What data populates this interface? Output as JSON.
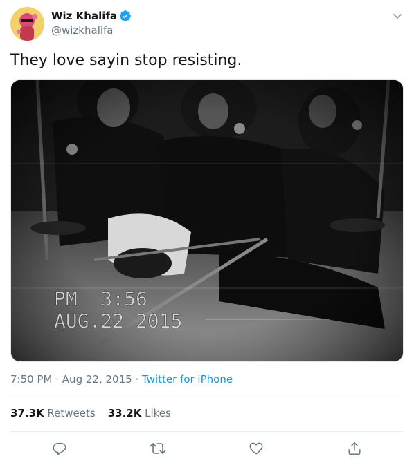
{
  "author": {
    "display_name": "Wiz Khalifa",
    "handle": "@wizkhalifa",
    "verified": true
  },
  "tweet": {
    "text": "They love sayin stop resisting.",
    "time": "7:50 PM",
    "separator": "·",
    "date": "Aug 22, 2015",
    "source": "Twitter for iPhone"
  },
  "media": {
    "timestamp_line1": "PM  3:56",
    "timestamp_line2": "AUG.22 2015"
  },
  "stats": {
    "retweets_count": "37.3K",
    "retweets_label": "Retweets",
    "likes_count": "33.2K",
    "likes_label": "Likes"
  },
  "icons": {
    "verified": "verified-badge-icon",
    "menu": "chevron-down-icon",
    "reply": "reply-icon",
    "retweet": "retweet-icon",
    "like": "heart-icon",
    "share": "share-icon"
  },
  "colors": {
    "accent": "#1da1f2",
    "link": "#1b95e0",
    "secondary_text": "#657786",
    "primary_text": "#14171a",
    "divider": "#e6ecf0"
  }
}
